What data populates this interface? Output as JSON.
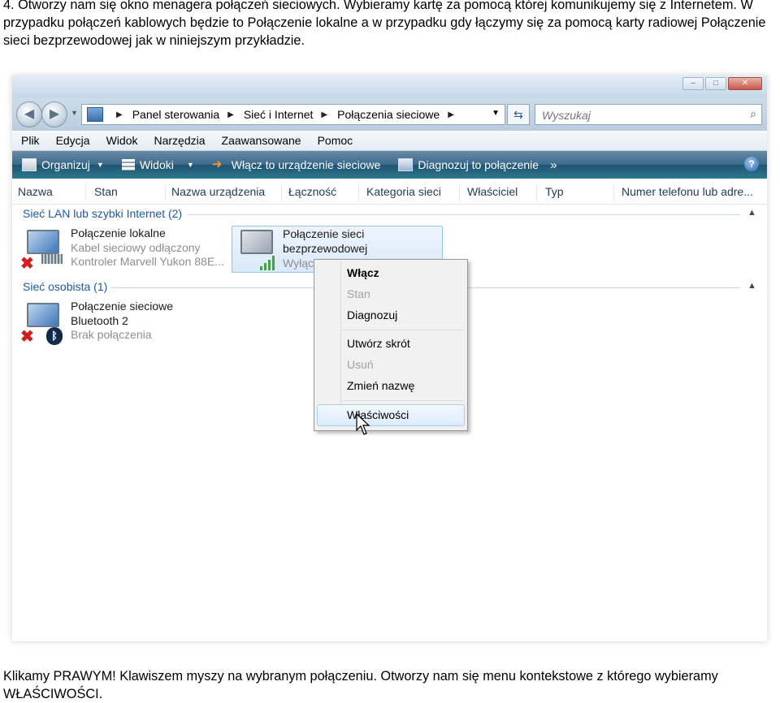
{
  "document": {
    "intro": "4. Otworzy nam się okno menagera połączeń sieciowych. Wybieramy kartę za pomocą której komunikujemy się z Internetem. W przypadku połączeń kablowych będzie to Połączenie lokalne a w przypadku gdy łączymy się za pomocą karty radiowej Połączenie sieci bezprzewodowej jak w niniejszym przykładzie.",
    "outro": "Klikamy PRAWYM! Klawiszem myszy na wybranym połączeniu. Otworzy nam się menu kontekstowe z którego wybieramy WŁAŚCIWOŚCI."
  },
  "window": {
    "address": {
      "crumbs": [
        "Panel sterowania",
        "Sieć i Internet",
        "Połączenia sieciowe"
      ]
    },
    "search": {
      "placeholder": "Wyszukaj"
    },
    "menu": [
      "Plik",
      "Edycja",
      "Widok",
      "Narzędzia",
      "Zaawansowane",
      "Pomoc"
    ],
    "toolbar": {
      "organize": "Organizuj",
      "views": "Widoki",
      "enable_device": "Włącz to urządzenie sieciowe",
      "diagnose": "Diagnozuj to połączenie",
      "more": "»",
      "help": "?"
    },
    "columns": [
      "Nazwa",
      "Stan",
      "Nazwa urządzenia",
      "Łączność",
      "Kategoria sieci",
      "Właściciel",
      "Typ",
      "Numer telefonu lub adre..."
    ],
    "groups": [
      {
        "title": "Sieć LAN lub szybki Internet (2)",
        "items": [
          {
            "name": "Połączenie lokalne",
            "status": "Kabel sieciowy odłączony",
            "device": "Kontroler Marvell Yukon 88E..."
          },
          {
            "name": "Połączenie sieci bezprzewodowej",
            "name_line1": "Połączenie sieci",
            "name_line2": "bezprzewodowej",
            "status": "Wyłąc"
          }
        ]
      },
      {
        "title": "Sieć osobista (1)",
        "items": [
          {
            "name_line1": "Połączenie sieciowe",
            "name_line2": "Bluetooth 2",
            "status": "Brak połączenia"
          }
        ]
      }
    ],
    "context_menu": [
      {
        "label": "Włącz",
        "state": "default-bold"
      },
      {
        "label": "Stan",
        "state": "disabled"
      },
      {
        "label": "Diagnozuj",
        "state": "enabled"
      },
      {
        "label": "Utwórz skrót",
        "state": "enabled"
      },
      {
        "label": "Usuń",
        "state": "disabled"
      },
      {
        "label": "Zmień nazwę",
        "state": "enabled"
      },
      {
        "label": "Właściwości",
        "state": "hovered"
      }
    ]
  },
  "colors": {
    "accent": "#1e5aa0",
    "toolbar": "#2a5f80",
    "selection": "#d9e9f8"
  }
}
